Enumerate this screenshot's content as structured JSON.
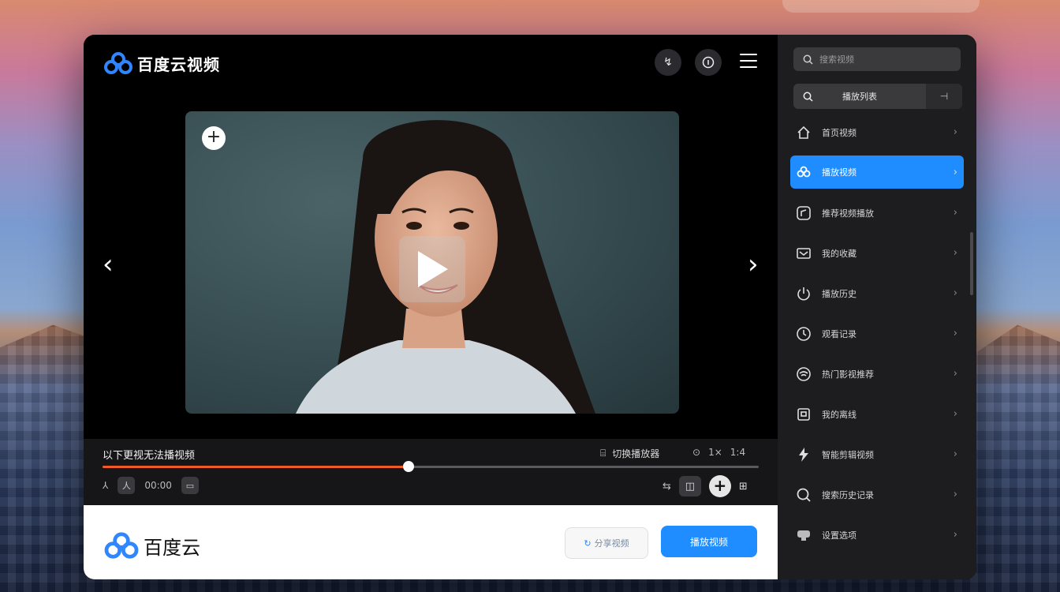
{
  "app": {
    "title": "百度云视频",
    "footer_brand": "百度云",
    "accent_color": "#1f8cff",
    "progress_color": "#f05a28"
  },
  "header": {
    "icons": [
      "share-icon",
      "info-icon",
      "menu-icon"
    ]
  },
  "player": {
    "now_playing": "以下更视无法播视频",
    "mid_label": "切换播放器",
    "right_labels": [
      "⊙",
      "1×",
      "1:4"
    ],
    "progress_fraction": 0.466,
    "left_controls": [
      "人",
      "00:00"
    ],
    "right_controls": [
      "⇆",
      "◫",
      "+",
      "⊞"
    ]
  },
  "footer": {
    "secondary_button": "分享视频",
    "primary_button": "播放视频"
  },
  "sidebar": {
    "search_placeholder": "搜索视频",
    "segment_label": "播放列表",
    "segment_side": "⊣",
    "items": [
      {
        "label": "首页视频",
        "icon": "home-icon",
        "active": false
      },
      {
        "label": "播放视频",
        "icon": "cloud-icon",
        "active": true
      },
      {
        "label": "推荐视频播放",
        "icon": "music-icon",
        "active": false
      },
      {
        "label": "我的收藏",
        "icon": "mail-icon",
        "active": false
      },
      {
        "label": "播放历史",
        "icon": "power-icon",
        "active": false
      },
      {
        "label": "观看记录",
        "icon": "clock-icon",
        "active": false
      },
      {
        "label": "热门影视推荐",
        "icon": "wifi-icon",
        "active": false
      },
      {
        "label": "我的离线",
        "icon": "box-icon",
        "active": false
      },
      {
        "label": "智能剪辑视频",
        "icon": "bolt-icon",
        "active": false
      },
      {
        "label": "搜索历史记录",
        "icon": "search-icon",
        "active": false
      },
      {
        "label": "设置选项",
        "icon": "chat-icon",
        "active": false
      }
    ]
  }
}
